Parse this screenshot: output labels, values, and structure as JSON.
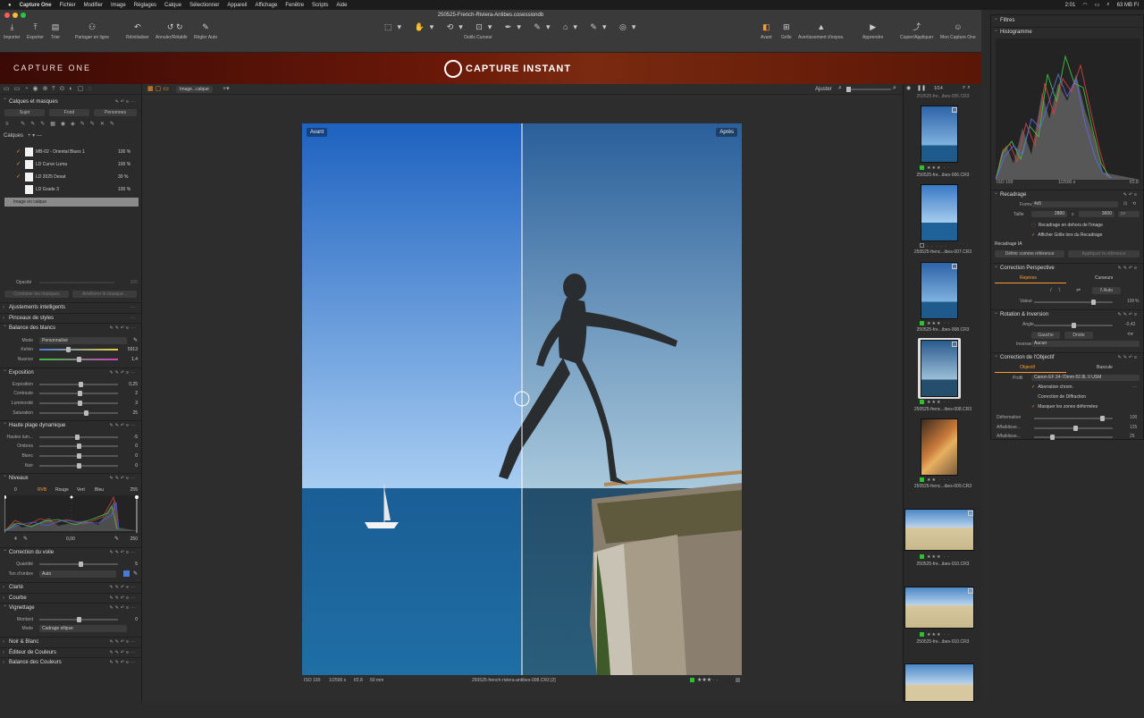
{
  "menubar": {
    "app": "Capture One",
    "items": [
      "Fichier",
      "Modifier",
      "Image",
      "Réglages",
      "Calque",
      "Sélectionner",
      "Appareil",
      "Affichage",
      "Fenêtre",
      "Scripts",
      "Aide"
    ],
    "time": "2:01",
    "memory": "63 MB FI"
  },
  "window": {
    "title": "250525-French-Riviera-Antibes.cosessiondb"
  },
  "toolbar": {
    "importer": "Importer",
    "exporter": "Exporter",
    "trier": "Trier",
    "partager": "Partager en ligne",
    "reinitialiser": "Réinitialiser",
    "annuler": "Annuler/Rétablir",
    "regler_auto": "Régler Auto",
    "outils_curseur": "Outils Curseur",
    "avant": "Avant",
    "grille": "Grille",
    "avertissement": "Avertissement d'expos.",
    "apprendre": "Apprendre",
    "copier": "Copier/Appliquer",
    "mon_compte": "Mon Capture One"
  },
  "banner": {
    "brand": "CAPTURE ONE",
    "logo_text": "CAPTURE INSTANT"
  },
  "left": {
    "layers_title": "Calques et masques",
    "mask_buttons": [
      "Sujet",
      "Fond",
      "Personnes"
    ],
    "layers_label": "Calques",
    "layers": [
      {
        "name": "MB-02 - Oriental Blues 1",
        "pct": "100 %"
      },
      {
        "name": "LD Curve Luma",
        "pct": "100 %"
      },
      {
        "name": "LD 2025 Desat",
        "pct": "30 %"
      },
      {
        "name": "LD Grade 3",
        "pct": "100 %"
      }
    ],
    "image_layer": "Image en calque",
    "opacity_label": "Opacité",
    "opacity_value": "100",
    "combine_btn": "Combiner les masques",
    "improve_btn": "Améliorer le masque...",
    "smart_adj": "Ajustements intelligents",
    "style_brushes": "Pinceaux de styles",
    "wb_title": "Balance des blancs",
    "wb_mode_label": "Mode",
    "wb_mode_value": "Personnalisé",
    "kelvin_label": "Kelvin",
    "kelvin_value": "5913",
    "nuance_label": "Nuance",
    "nuance_value": "1,4",
    "exposure_title": "Exposition",
    "exposure": [
      {
        "label": "Exposition",
        "value": "0,25"
      },
      {
        "label": "Contraste",
        "value": "2"
      },
      {
        "label": "Luminosité",
        "value": "3"
      },
      {
        "label": "Saturation",
        "value": "25"
      }
    ],
    "hdr_title": "Haute plage dynamique",
    "hdr": [
      {
        "label": "Hautes lum...",
        "value": "-5"
      },
      {
        "label": "Ombres",
        "value": "0"
      },
      {
        "label": "Blanc",
        "value": "0"
      },
      {
        "label": "Noir",
        "value": "0"
      }
    ],
    "levels_title": "Niveaux",
    "levels_tabs": [
      "RVB",
      "Rouge",
      "Vert",
      "Bleu"
    ],
    "levels_in_low": "0",
    "levels_in_high": "255",
    "levels_out_low": "4",
    "levels_mid": "0,00",
    "levels_out_high": "250",
    "haze_title": "Correction du voile",
    "haze_qty_label": "Quantité",
    "haze_qty_value": "5",
    "haze_tone_label": "Ton d'ombre",
    "haze_tone_value": "Auto",
    "clarte": "Clarté",
    "courbe": "Courbe",
    "vignette_title": "Vignettage",
    "vignette_amount_label": "Montant",
    "vignette_amount_value": "0",
    "vignette_mode_label": "Mode",
    "vignette_mode_value": "Cadrage ellipse",
    "nb": "Noir & Blanc",
    "editeur": "Éditeur de Couleurs",
    "balance_couleurs": "Balance des Couleurs"
  },
  "viewer": {
    "layer_select": "Image...calque",
    "ajuster": "Ajuster",
    "before": "Avant",
    "after": "Après",
    "iso": "ISO 100",
    "shutter": "1/2500 s",
    "aperture": "f/2.8",
    "focal": "50 mm",
    "filename": "250525-french-riviera-antibes-008.CR3 [2]"
  },
  "film": {
    "counter": "1/14",
    "items": [
      {
        "name": "250525-fre...ibes-006.CR3",
        "badge": "2"
      },
      {
        "name": "250525-frenc...ibes-007.CR3",
        "badge": ""
      },
      {
        "name": "250525-fre...ibes-008.CR3",
        "badge": "1"
      },
      {
        "name": "250525-frenc...ibes-008.CR3",
        "badge": "2"
      },
      {
        "name": "250525-frenc...ibes-009.CR3",
        "badge": ""
      },
      {
        "name": "250525-fre...ibes-010.CR3",
        "badge": "1"
      },
      {
        "name": "250525-fre...ibes-010.CR3",
        "badge": "2"
      }
    ]
  },
  "right": {
    "filtres": "Filtres",
    "histogram": "Histogramme",
    "hist_iso": "ISO 100",
    "hist_shutter": "1/2500 s",
    "hist_aperture": "f/2.8",
    "crop_title": "Recadrage",
    "format_label": "Format",
    "format_value": "4x5",
    "size_label": "Taille",
    "size_w": "2880",
    "size_x": "x",
    "size_h": "3600",
    "size_unit": "px",
    "crop_outside": "Recadrage en dehors de l'image",
    "crop_grid": "Afficher Grille lors du Recadrage",
    "ai_crop": "Recadrage IA",
    "define_ref": "Définir comme référence",
    "apply_ref": "Appliquer la référence",
    "persp_title": "Correction Perspective",
    "persp_tabs": [
      "Repères",
      "Curseurs"
    ],
    "persp_auto": "Auto",
    "persp_value_label": "Valeur",
    "persp_value": "100",
    "persp_pct": "%",
    "rot_title": "Rotation & Inversion",
    "angle_label": "Angle",
    "angle_value": "-0,42",
    "left_btn": "Gauche",
    "right_btn": "Droite",
    "invert_label": "Inverser",
    "invert_value": "Aucun",
    "lens_title": "Correction de l'Objectif",
    "lens_tabs": [
      "Objectif",
      "Bascule"
    ],
    "profile_label": "Profil",
    "profile_value": "Canon EF 24-70mm f/2.8L II USM",
    "chroma": "Aberration chrom.",
    "diffraction": "Correction de Diffraction",
    "hide_deformed": "Masquer les zones déformées",
    "lens_sliders": [
      {
        "label": "Déformation",
        "value": "100"
      },
      {
        "label": "Affaiblisse...",
        "value": "125"
      },
      {
        "label": "Affaiblisse...",
        "value": "25"
      }
    ]
  }
}
